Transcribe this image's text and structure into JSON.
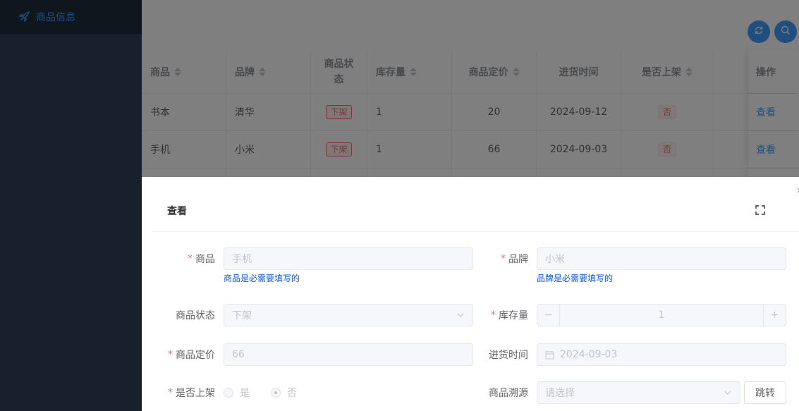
{
  "sidebar": {
    "items": [
      {
        "label": "商品信息",
        "icon": "rocket-icon"
      }
    ]
  },
  "toolbar": {
    "refresh_icon": "refresh-icon",
    "search_icon": "search-icon"
  },
  "table": {
    "headers": {
      "product": "商品",
      "brand": "品牌",
      "status_line1": "商品状",
      "status_line2": "态",
      "stock": "库存量",
      "price": "商品定价",
      "purchase_time": "进货时间",
      "listed": "是否上架",
      "action": "操作"
    },
    "rows": [
      {
        "product": "书本",
        "brand": "清华",
        "status": "下架",
        "stock": "1",
        "price": "20",
        "purchase_time": "2024-09-12",
        "listed": "否",
        "action": "查看"
      },
      {
        "product": "手机",
        "brand": "小米",
        "status": "下架",
        "stock": "1",
        "price": "66",
        "purchase_time": "2024-09-03",
        "listed": "否",
        "action": "查看"
      }
    ]
  },
  "dialog": {
    "title": "查看",
    "close": "×",
    "fields": {
      "product": {
        "label": "商品",
        "value": "手机",
        "hint": "商品是必需要填写的"
      },
      "brand": {
        "label": "品牌",
        "value": "小米",
        "hint": "品牌是必需要填写的"
      },
      "status": {
        "label": "商品状态",
        "value": "下架"
      },
      "stock": {
        "label": "库存量",
        "value": "1",
        "minus": "−",
        "plus": "+"
      },
      "price": {
        "label": "商品定价",
        "value": "66"
      },
      "purchase_time": {
        "label": "进货时间",
        "value": "2024-09-03"
      },
      "listed": {
        "label": "是否上架",
        "options": [
          "是",
          "否"
        ],
        "selected": "否"
      },
      "source": {
        "label": "商品溯源",
        "placeholder": "请选择",
        "jump": "跳转"
      }
    },
    "required_mark": "*"
  },
  "colors": {
    "sidebar_bg": "#304156",
    "accent": "#409eff",
    "danger": "#f56c6c",
    "hint": "#0b56d4"
  }
}
